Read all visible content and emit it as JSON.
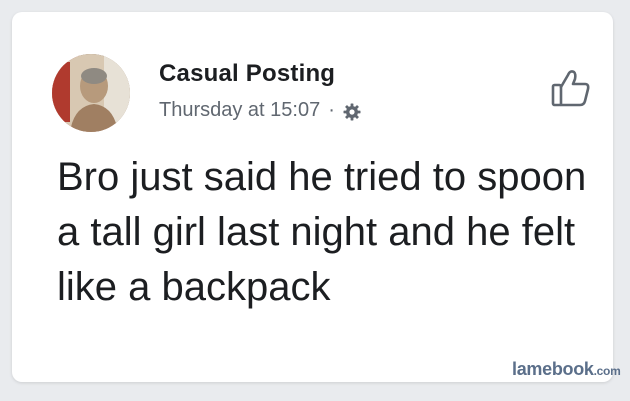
{
  "post": {
    "author": "Casual Posting",
    "timestamp": "Thursday at 15:07",
    "separator": "·",
    "audience_icon": "gear-icon",
    "text": "Bro just said he tried to spoon a tall girl last night and he felt like a backpack"
  },
  "actions": {
    "like_icon": "thumbs-up-icon"
  },
  "watermark": {
    "main": "lamebook",
    "suffix": ".com"
  },
  "colors": {
    "name_text": "#1c1e21",
    "meta_text": "#606770",
    "watermark": "#5b6f8a"
  }
}
